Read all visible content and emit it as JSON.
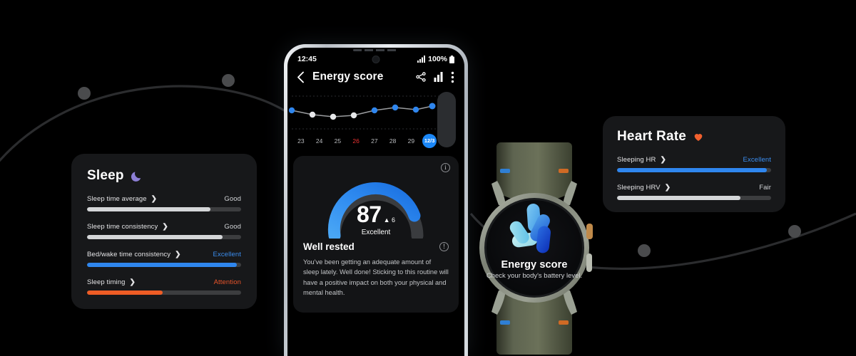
{
  "sleep_card": {
    "title": "Sleep",
    "icon": "crescent-moon-icon",
    "metrics": [
      {
        "label": "Sleep time average",
        "value": "Good",
        "value_color": "#d2d4d7",
        "fill": 80,
        "fill_color": "#d4d6d8"
      },
      {
        "label": "Sleep time consistency",
        "value": "Good",
        "value_color": "#d2d4d7",
        "fill": 88,
        "fill_color": "#d4d6d8"
      },
      {
        "label": "Bed/wake time consistency",
        "value": "Excellent",
        "value_color": "#3b8ef0",
        "fill": 97,
        "fill_color": "#2f86ee"
      },
      {
        "label": "Sleep timing",
        "value": "Attention",
        "value_color": "#e8542a",
        "fill": 49,
        "fill_color": "#ee5c25"
      }
    ]
  },
  "heart_rate_card": {
    "title": "Heart Rate",
    "icon": "heart-icon",
    "metrics": [
      {
        "label": "Sleeping HR",
        "value": "Excellent",
        "value_color": "#3b8ef0",
        "fill": 97,
        "fill_color": "#2f86ee"
      },
      {
        "label": "Sleeping HRV",
        "value": "Fair",
        "value_color": "#d2d4d7",
        "fill": 80,
        "fill_color": "#d4d6d8"
      }
    ]
  },
  "phone": {
    "status": {
      "time": "12:45",
      "battery": "100%",
      "signal_icon": "cellular-signal-icon",
      "battery_icon": "battery-full-icon"
    },
    "app_bar": {
      "back_icon": "chevron-left-icon",
      "title": "Energy score",
      "share_icon": "share-icon",
      "chart_icon": "bar-chart-icon",
      "more_icon": "more-vertical-icon"
    },
    "score": {
      "value": "87",
      "delta": "6",
      "delta_icon": "triangle-up-icon",
      "rating": "Excellent",
      "info_icon": "info-circle-icon",
      "warn_icon": "exclamation-circle-icon",
      "headline": "Well rested",
      "description": "You've been getting an adequate amount of sleep lately. Well done! Sticking to this routine will have a positive impact on both your physical and mental health."
    }
  },
  "watch": {
    "title": "Energy score",
    "subtitle": "Check your body's battery level.",
    "logo_icon": "energy-score-petal-logo"
  },
  "chart_data": {
    "type": "line",
    "title": "Energy score",
    "xlabel": "",
    "ylabel": "",
    "ylim": [
      0,
      100
    ],
    "grid": true,
    "legend": false,
    "y_top_tick": "100",
    "categories": [
      "23",
      "24",
      "25",
      "26",
      "27",
      "28",
      "29",
      "12/3"
    ],
    "tick_styles": [
      "normal",
      "normal",
      "normal",
      "danger",
      "normal",
      "normal",
      "normal",
      "active"
    ],
    "values": [
      72,
      66,
      62,
      65,
      73,
      78,
      74,
      81
    ],
    "point_colors": [
      "#2f86ee",
      "#e6e7e9",
      "#e6e7e9",
      "#e6e7e9",
      "#2f86ee",
      "#2f86ee",
      "#2f86ee",
      "#2f86ee"
    ],
    "line_color": "#9a9c9f",
    "highlight_index": 7
  },
  "background": {
    "curve_color": "#2b2c2e",
    "node_color": "#4a4b4d"
  }
}
